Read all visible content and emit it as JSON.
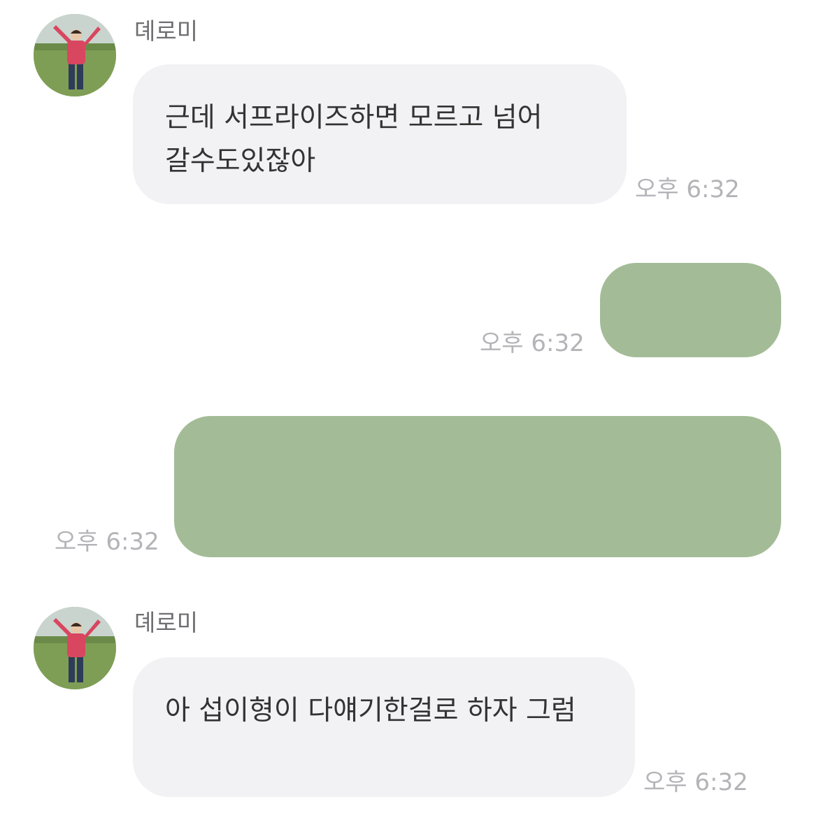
{
  "messages": [
    {
      "direction": "incoming",
      "sender": "뎨로미",
      "avatar": "profile-photo-person-in-field",
      "text": "근데 서프라이즈하면 모르고 넘어 갈수도있잖아",
      "time": "오후 6:32"
    },
    {
      "direction": "outgoing",
      "text": "",
      "time": "오후 6:32"
    },
    {
      "direction": "outgoing",
      "text": "",
      "time": "오후 6:32"
    },
    {
      "direction": "incoming",
      "sender": "뎨로미",
      "avatar": "profile-photo-person-in-field",
      "text": "아 섭이형이 다얘기한걸로 하자 그럼",
      "time": "오후 6:32"
    }
  ],
  "colors": {
    "incoming_bubble": "#f2f2f5",
    "outgoing_bubble": "#a3bc97",
    "timestamp": "#b4b4b8",
    "sender_name": "#6e6e73"
  }
}
